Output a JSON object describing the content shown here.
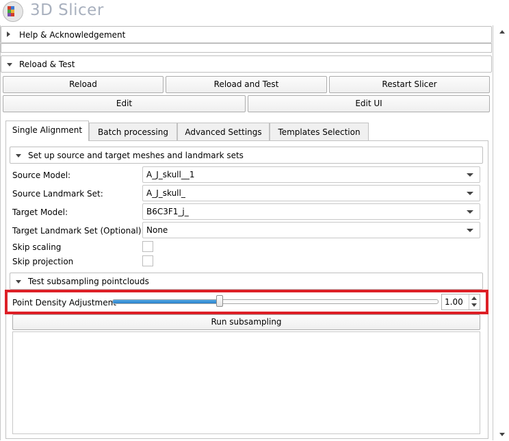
{
  "app": {
    "title": "3D Slicer"
  },
  "sections": {
    "help": {
      "label": "Help & Acknowledgement",
      "collapsed": true
    },
    "reload": {
      "label": "Reload & Test",
      "collapsed": false
    }
  },
  "buttons": {
    "reload": "Reload",
    "reload_and_test": "Reload and Test",
    "restart": "Restart Slicer",
    "edit": "Edit",
    "edit_ui": "Edit UI",
    "run_subsampling": "Run subsampling"
  },
  "tabs": [
    {
      "label": "Single Alignment",
      "active": true
    },
    {
      "label": "Batch processing",
      "active": false
    },
    {
      "label": "Advanced Settings",
      "active": false
    },
    {
      "label": "Templates Selection",
      "active": false
    }
  ],
  "setup": {
    "header": "Set up source and target meshes and landmark sets",
    "source_model_label": "Source Model:",
    "source_model_value": "A_J_skull__1",
    "source_landmark_label": "Source Landmark Set:",
    "source_landmark_value": "A_J_skull_",
    "target_model_label": "Target Model:",
    "target_model_value": "B6C3F1_j_",
    "target_landmark_label": "Target Landmark Set (Optional):",
    "target_landmark_value": "None",
    "skip_scaling_label": "Skip scaling",
    "skip_projection_label": "Skip projection"
  },
  "subsampling": {
    "header": "Test subsampling pointclouds",
    "density_label": "Point Density Adjustment",
    "density_value": "1.00",
    "slider_fraction": 0.33
  },
  "colors": {
    "highlight": "#dd1f26",
    "slider_fill": "#2b80c9"
  }
}
